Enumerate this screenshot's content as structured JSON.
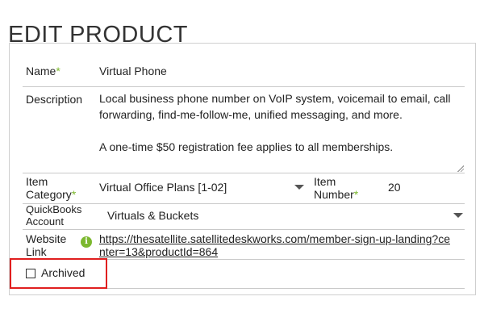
{
  "page": {
    "title": "EDIT PRODUCT"
  },
  "form": {
    "required_mark": "*",
    "name": {
      "label": "Name",
      "value": "Virtual Phone"
    },
    "description": {
      "label": "Description",
      "paragraphs": [
        "Local business phone number on VoIP system, voicemail to email, call forwarding, find-me-follow-me, unified messaging, and more.",
        "A one-time $50 registration fee applies to all memberships."
      ]
    },
    "item_category": {
      "label_line1": "Item",
      "label_line2": "Category",
      "value": "Virtual Office Plans [1-02]"
    },
    "item_number": {
      "label_line1": "Item",
      "label_line2": "Number",
      "value": "20"
    },
    "quickbooks_account": {
      "label_line1": "QuickBooks",
      "label_line2": "Account",
      "value": "Virtuals & Buckets"
    },
    "website_link": {
      "label_line1": "Website",
      "label_line2": "Link",
      "info_glyph": "i",
      "url": "https://thesatellite.satellitedeskworks.com/member-sign-up-landing?center=13&productId=864"
    },
    "archived": {
      "label": "Archived",
      "checked": false
    }
  },
  "colors": {
    "required": "#7cb82f",
    "highlight": "#e01f1f",
    "info_icon": "#7cb82f"
  }
}
